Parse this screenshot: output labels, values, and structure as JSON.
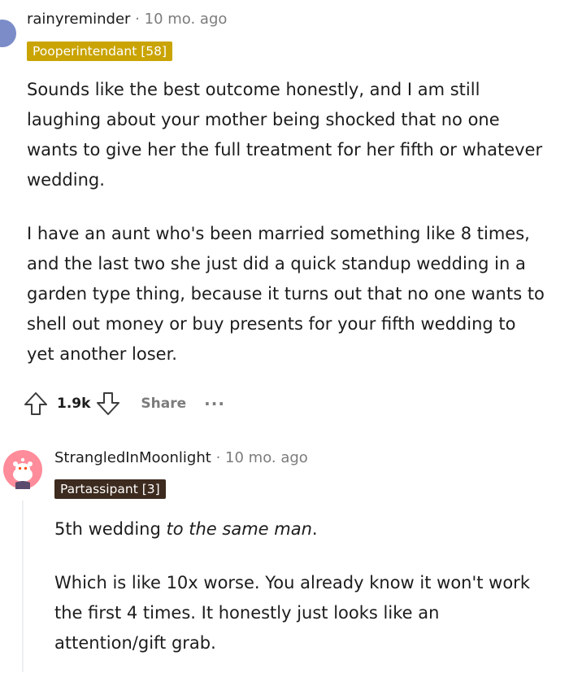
{
  "comment1": {
    "username": "rainyreminder",
    "separator": "·",
    "time": "10 mo. ago",
    "flair": "Pooperintendant [58]",
    "paragraph1": "Sounds like the best outcome honestly, and I am still laughing about your mother being shocked that no one wants to give her the full treatment for her fifth or whatever wedding.",
    "paragraph2": "I have an aunt who's been married something like 8 times, and the last two she just did a quick standup wedding in a garden type thing, because it turns out that no one wants to shell out money or buy presents for your fifth wedding to yet another loser.",
    "score": "1.9k",
    "share_label": "Share",
    "more_label": "···"
  },
  "comment2": {
    "username": "StrangledInMoonlight",
    "separator": "·",
    "time": "10 mo. ago",
    "flair": "Partassipant [3]",
    "paragraph1_plain": "5th wedding ",
    "paragraph1_emph": "to the same man",
    "paragraph1_end": ".",
    "paragraph2": "Which is like 10x worse. You already know it won't work the first 4 times. It honestly just looks like an attention/gift grab."
  },
  "colors": {
    "flair1_bg": "#c9a404",
    "flair2_bg": "#3d2b1f",
    "avatar1": "#7b8cc9",
    "avatar2": "#ff8c9a",
    "muted": "#7c7c7c"
  },
  "icons": {
    "upvote": "arrow-up-icon",
    "downvote": "arrow-down-icon",
    "avatar2": "snoo-avatar-icon"
  }
}
